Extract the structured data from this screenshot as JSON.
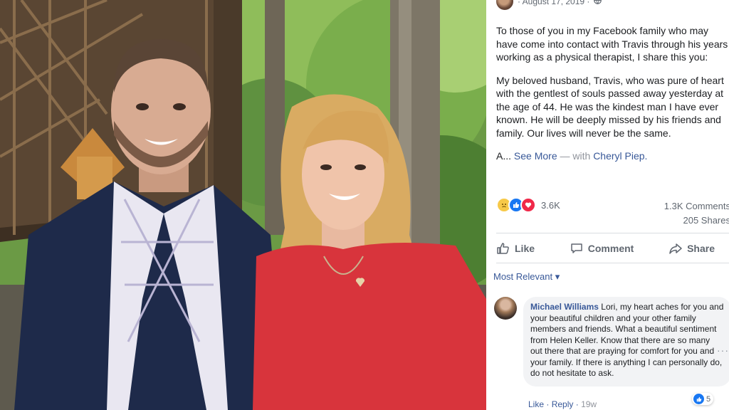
{
  "post": {
    "date": "August 17, 2019",
    "date_sep": "·",
    "paragraph1": "To those of you in my Facebook family who may have come into contact with Travis through his years working as a physical therapist, I share this you:",
    "paragraph2": "My beloved husband, Travis, who was pure of heart with the gentlest of souls passed away yesterday at the age of 44. He was the kindest man I have ever known. He will be deeply missed by his friends and family. Our lives will never be the same.",
    "truncated_start": "A...",
    "see_more": "See More",
    "with_text": "— with",
    "tagged_name": "Cheryl Piep."
  },
  "reactions": {
    "count": "3.6K",
    "icons": [
      "sad-icon",
      "like-icon",
      "love-icon"
    ]
  },
  "stats": {
    "comments": "1.3K Comments",
    "shares": "205 Shares"
  },
  "actions": {
    "like": "Like",
    "comment": "Comment",
    "share": "Share"
  },
  "sort": {
    "label": "Most Relevant",
    "caret": "▾"
  },
  "comment": {
    "author": "Michael Williams",
    "text": "Lori, my heart aches for you and your beautiful children and your other family members and friends. What a beautiful sentiment from Helen Keller. Know that there are so many out there that are praying for comfort for you and your family. If there is anything I can personally do, do not hesitate to ask.",
    "reaction_count": "5",
    "like_label": "Like",
    "reply_label": "Reply",
    "age": "19w",
    "sep": "·"
  },
  "colors": {
    "link": "#385898",
    "muted": "#606770",
    "like_blue": "#1877f2",
    "love_red": "#f02849",
    "dress_red": "#d8343c",
    "jacket_navy": "#1e2a4a"
  }
}
